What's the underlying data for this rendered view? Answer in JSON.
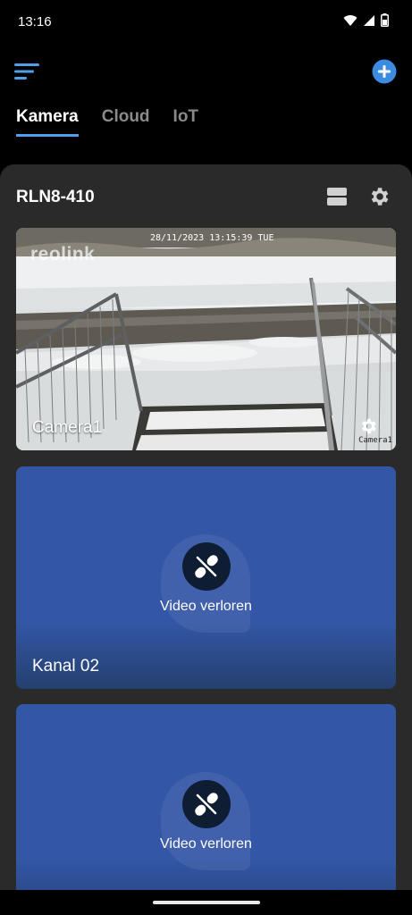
{
  "status_bar": {
    "time": "13:16"
  },
  "tabs": [
    {
      "label": "Kamera",
      "active": true
    },
    {
      "label": "Cloud",
      "active": false
    },
    {
      "label": "IoT",
      "active": false
    }
  ],
  "device": {
    "name": "RLN8-410"
  },
  "channels": [
    {
      "label": "Camera1",
      "status": "live",
      "osd_timestamp": "28/11/2023 13:15:39 TUE",
      "osd_logo": "reolink",
      "osd_name": "Camera1"
    },
    {
      "label": "Kanal 02",
      "status": "lost",
      "status_text": "Video verloren"
    },
    {
      "label": "",
      "status": "lost",
      "status_text": "Video verloren"
    }
  ],
  "colors": {
    "accent": "#4ea1e8",
    "lost_tile": "#3356a6",
    "panel": "#2a2a2a"
  }
}
